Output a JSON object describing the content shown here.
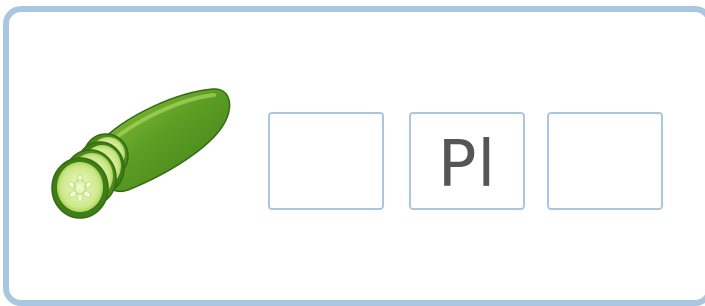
{
  "puzzle": {
    "picture": {
      "icon": "cucumber-icon",
      "colors": {
        "skin_dark": "#3f7d17",
        "skin_light": "#8cc53f",
        "flesh": "#d7ef9b",
        "seeds": "#f2fbd9"
      }
    },
    "slots": [
      {
        "value": ""
      },
      {
        "value": "Pl"
      },
      {
        "value": ""
      }
    ],
    "colors": {
      "border": "#a9c7e0",
      "text": "#555555"
    }
  }
}
